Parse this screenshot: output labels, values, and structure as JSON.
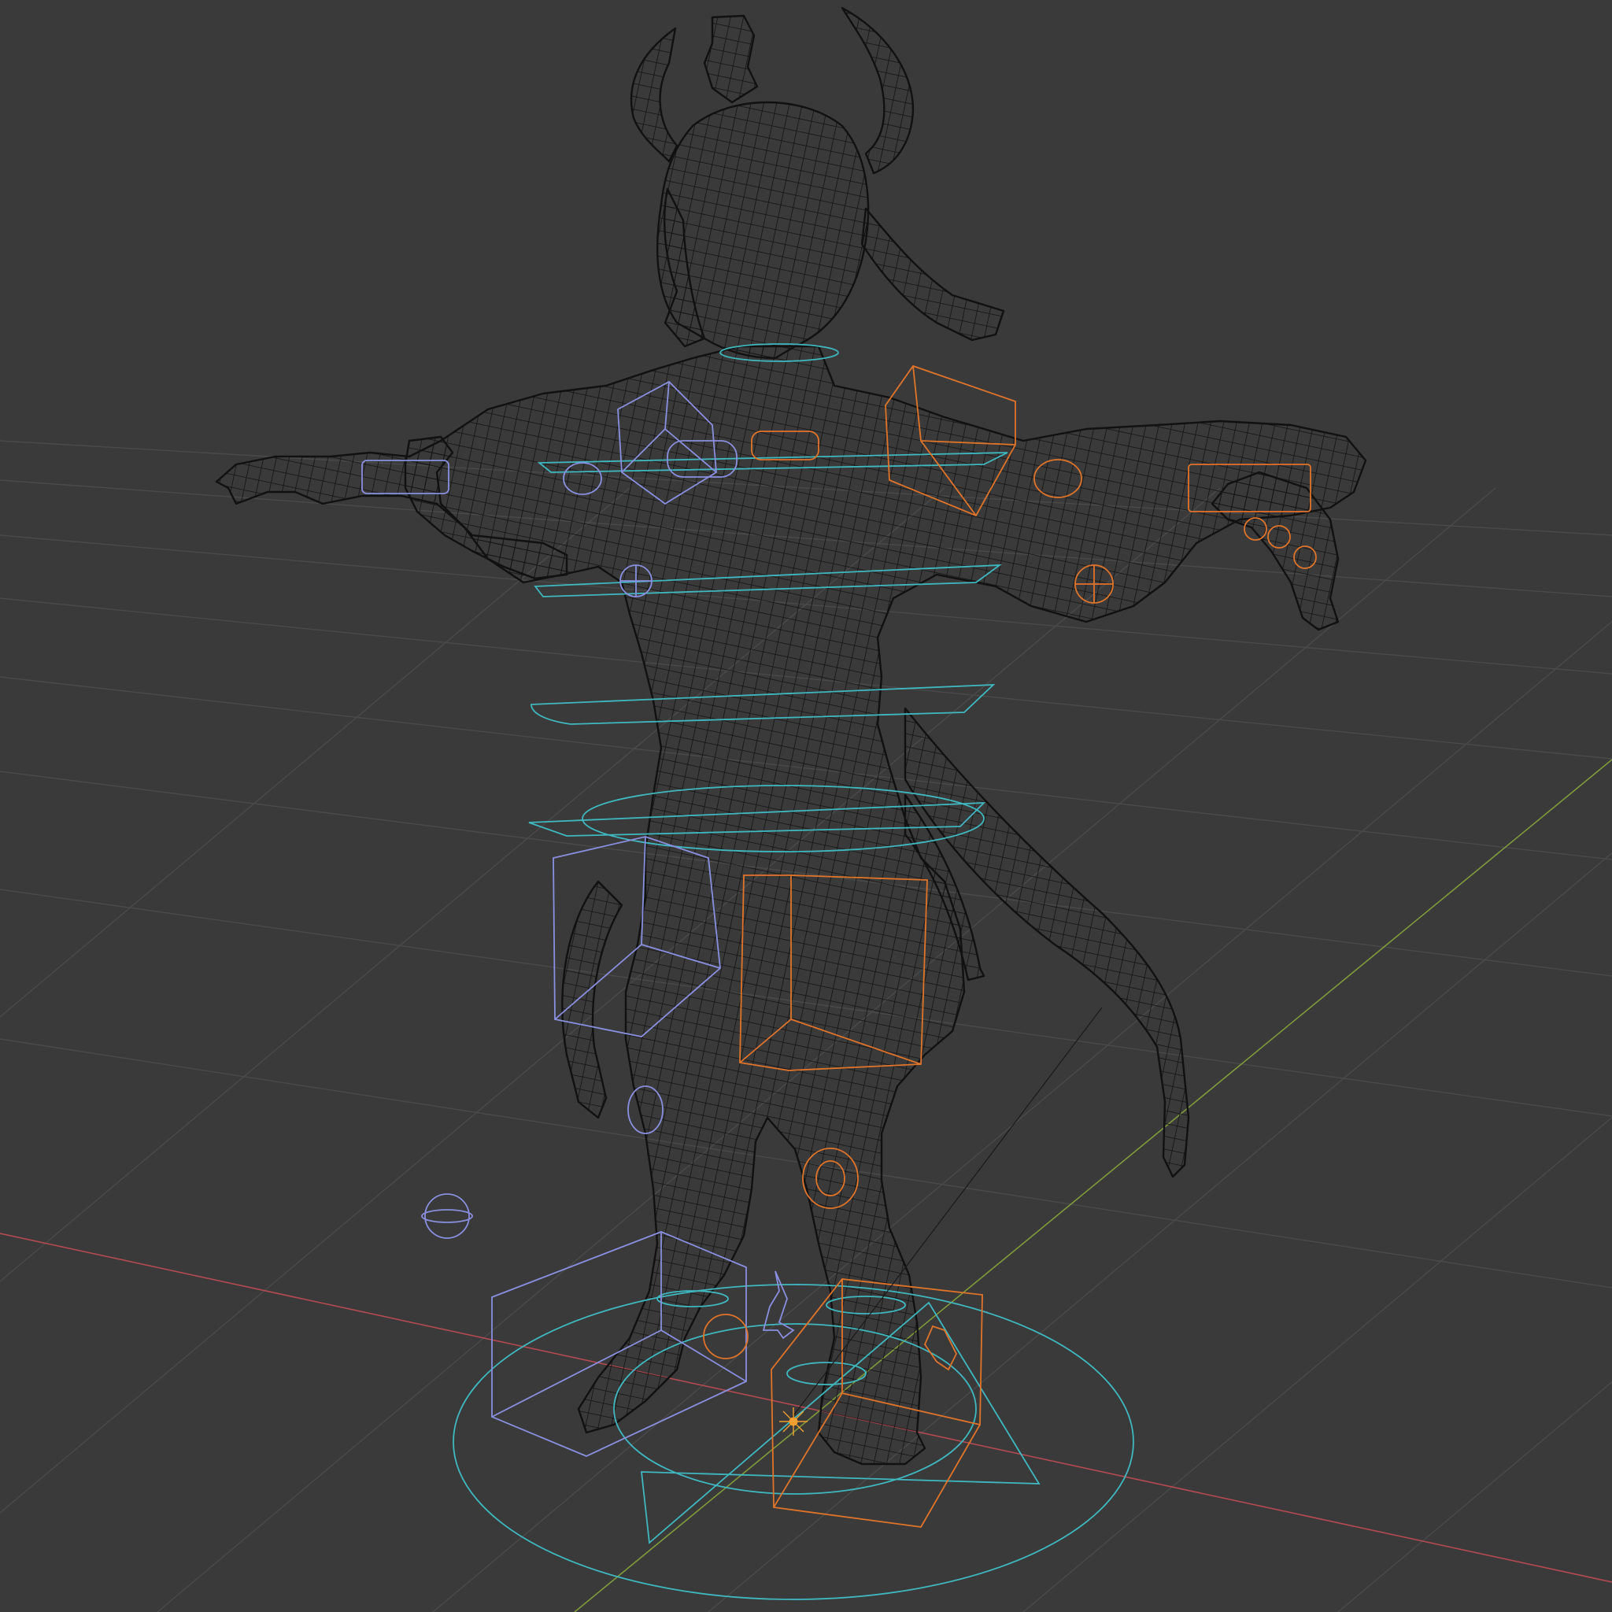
{
  "viewport": {
    "mode": "wireframe",
    "background": "#3a3a3a",
    "colors": {
      "grid": "#4a4a4a",
      "x_axis": "#b44a52",
      "y_axis": "#7f9a3a",
      "mesh": "#111111",
      "ctrl_center": "#3fb8c0",
      "ctrl_left": "#8a8fe0",
      "ctrl_right": "#e0742a",
      "origin": "#f0a030"
    },
    "objects": [
      {
        "name": "character-mesh",
        "type": "mesh"
      },
      {
        "name": "rig-controls",
        "type": "armature-widgets"
      },
      {
        "name": "world-grid",
        "type": "grid"
      }
    ]
  }
}
